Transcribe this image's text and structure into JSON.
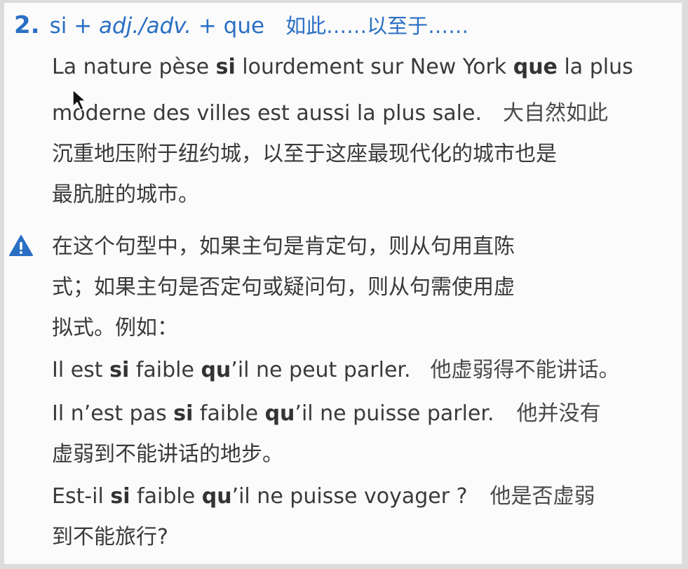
{
  "heading": {
    "number": "2.",
    "f1": "si + ",
    "f2": "adj./adv.",
    "f3": " + que",
    "zh": "如此……以至于……"
  },
  "example1": {
    "l1_a": "La nature pèse ",
    "l1_b": "si",
    "l1_c": " lourdement sur New York ",
    "l1_d": "que",
    "l1_e": " la plus",
    "l2_fr": "moderne des villes est aussi la plus sale.",
    "l2_zh": "大自然如此",
    "l3_zh": "沉重地压附于纽约城，以至于这座最现代化的城市也是",
    "l4_zh": "最肮脏的城市。"
  },
  "note": {
    "icon": "warning-icon",
    "l1": "在这个句型中，如果主句是肯定句，则从句用直陈",
    "l2": "式；如果主句是否定句或疑问句，则从句需使用虚",
    "l3": "拟式。例如："
  },
  "ex_a": {
    "a": "Il est ",
    "b": "si",
    "c": " faible ",
    "d": "qu",
    "e": "’il ne peut parler.",
    "zh": "他虚弱得不能讲话。"
  },
  "ex_b": {
    "a": "Il n’est pas ",
    "b": "si",
    "c": " faible ",
    "d": "qu",
    "e": "’il ne puisse parler.",
    "zh1": "他并没有",
    "zh2": "虚弱到不能讲话的地步。"
  },
  "ex_c": {
    "a": "Est-il ",
    "b": "si",
    "c": " faible ",
    "d": "qu",
    "e": "’il ne puisse voyager ?",
    "zh1": "他是否虚弱",
    "zh2": "到不能旅行?"
  },
  "colors": {
    "accent": "#2a6fc4",
    "text": "#3a3a3a"
  }
}
